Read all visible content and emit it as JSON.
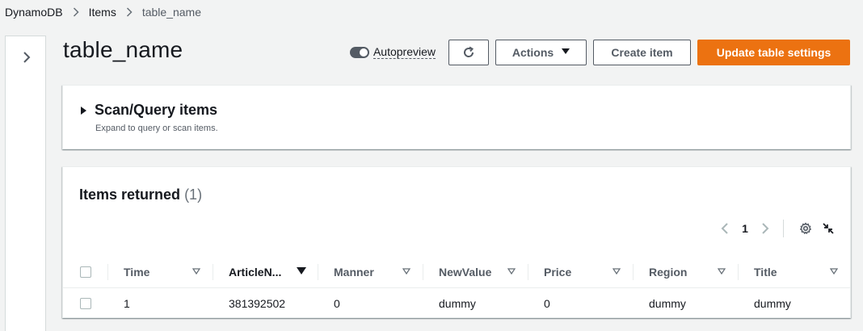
{
  "breadcrumb": {
    "items": [
      "DynamoDB",
      "Items",
      "table_name"
    ]
  },
  "page": {
    "title": "table_name"
  },
  "toolbar": {
    "autopreview_label": "Autopreview",
    "autopreview_on": true,
    "actions_label": "Actions",
    "create_item_label": "Create item",
    "update_settings_label": "Update table settings"
  },
  "scan": {
    "title": "Scan/Query items",
    "description": "Expand to query or scan items."
  },
  "items": {
    "title": "Items returned",
    "count": "(1)",
    "page": "1"
  },
  "table": {
    "columns": [
      {
        "label": "Time"
      },
      {
        "label": "ArticleN..."
      },
      {
        "label": "Manner"
      },
      {
        "label": "NewValue"
      },
      {
        "label": "Price"
      },
      {
        "label": "Region"
      },
      {
        "label": "Title"
      }
    ],
    "rows": [
      [
        "1",
        "381392502",
        "0",
        "dummy",
        "0",
        "dummy",
        "dummy"
      ]
    ]
  },
  "colors": {
    "primary": "#ec7211",
    "background": "#f2f3f3",
    "text": "#16191f",
    "muted": "#545b64"
  },
  "icons": {
    "breadcrumb_separator": "chevron-right-icon",
    "side_toggle": "chevron-right-icon",
    "refresh": "refresh-icon",
    "actions_caret": "caret-down-icon",
    "scan_expand": "caret-right-icon",
    "pager_prev": "chevron-left-icon",
    "pager_next": "chevron-right-icon",
    "settings": "gear-icon",
    "collapse": "shrink-icon",
    "sort": "caret-down-icon"
  }
}
